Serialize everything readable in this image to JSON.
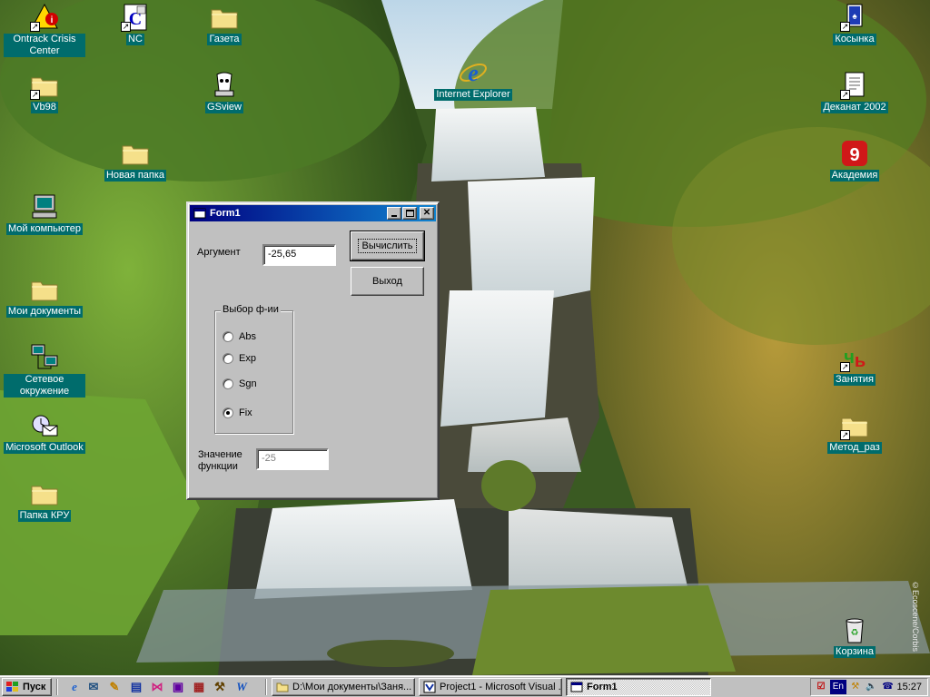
{
  "desktop": {
    "icons": [
      {
        "id": "ontrack",
        "label": "Ontrack Crisis Center",
        "icon": "ontrack-icon"
      },
      {
        "id": "nc",
        "label": "NC",
        "icon": "nc-icon"
      },
      {
        "id": "gazeta",
        "label": "Газета",
        "icon": "folder-icon"
      },
      {
        "id": "kosynka",
        "label": "Косынка",
        "icon": "solitaire-icon"
      },
      {
        "id": "vb98",
        "label": "Vb98",
        "icon": "folder-icon"
      },
      {
        "id": "gsview",
        "label": "GSview",
        "icon": "gsview-icon"
      },
      {
        "id": "ie",
        "label": "Internet Explorer",
        "icon": "internet-explorer-icon"
      },
      {
        "id": "dekanat",
        "label": "Деканат 2002",
        "icon": "dekanat-icon"
      },
      {
        "id": "newfolder",
        "label": "Новая папка",
        "icon": "folder-icon"
      },
      {
        "id": "akademia",
        "label": "Академия",
        "icon": "akademia-icon"
      },
      {
        "id": "mycomputer",
        "label": "Мой компьютер",
        "icon": "computer-icon"
      },
      {
        "id": "mydocs",
        "label": "Мои документы",
        "icon": "folder-icon"
      },
      {
        "id": "network",
        "label": "Сетевое окружение",
        "icon": "network-icon"
      },
      {
        "id": "zanyatia",
        "label": "Занятия",
        "icon": "zanyatia-icon"
      },
      {
        "id": "outlook",
        "label": "Microsoft Outlook",
        "icon": "outlook-icon"
      },
      {
        "id": "metod",
        "label": "Метод_раз",
        "icon": "folder-icon"
      },
      {
        "id": "kru",
        "label": "Папка КРУ",
        "icon": "folder-icon"
      },
      {
        "id": "recycle",
        "label": "Корзина",
        "icon": "recycle-bin-icon"
      }
    ],
    "watermark": "©Ecoscene/Corbis"
  },
  "form1": {
    "title": "Form1",
    "argument_label": "Аргумент",
    "argument_value": "-25,65",
    "calc_button": "Вычислить",
    "exit_button": "Выход",
    "group_title": "Выбор ф-ии",
    "options": [
      {
        "label": "Abs",
        "checked": false
      },
      {
        "label": "Exp",
        "checked": false
      },
      {
        "label": "Sgn",
        "checked": false
      },
      {
        "label": "Fix",
        "checked": true
      }
    ],
    "result_label_1": "Значение",
    "result_label_2": "функции",
    "result_value": "-25"
  },
  "taskbar": {
    "start_label": "Пуск",
    "tasks": [
      {
        "label": "D:\\Мои документы\\Заня...",
        "icon": "folder-icon",
        "active": false
      },
      {
        "label": "Project1 - Microsoft Visual ...",
        "icon": "vb-icon",
        "active": false
      },
      {
        "label": "Form1",
        "icon": "form-icon",
        "active": true
      }
    ],
    "tray": {
      "language": "En",
      "clock": "15:27"
    }
  },
  "colors": {
    "title_active": "#000080",
    "face": "#c0c0c0",
    "desktop_label_bg": "#006c6c"
  }
}
